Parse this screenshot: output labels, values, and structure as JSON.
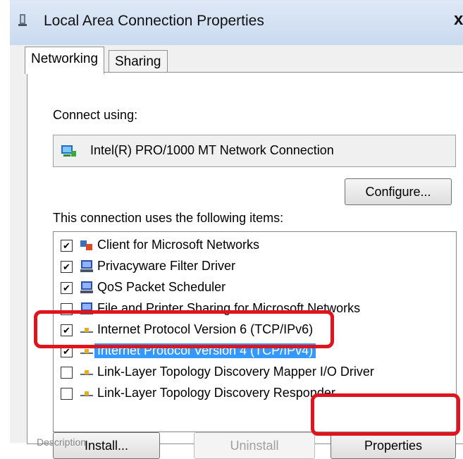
{
  "window": {
    "title": "Local Area Connection Properties",
    "close_label": "x"
  },
  "tabs": [
    {
      "label": "Networking"
    },
    {
      "label": "Sharing"
    }
  ],
  "connect_using": {
    "label": "Connect using:",
    "adapter": "Intel(R) PRO/1000 MT Network Connection",
    "configure_label": "Configure..."
  },
  "items_section": {
    "label": "This connection uses the following items:",
    "items": [
      {
        "label": "Client for Microsoft Networks",
        "checked": true,
        "icon": "network-client-icon"
      },
      {
        "label": "Privacyware Filter Driver",
        "checked": true,
        "icon": "monitor-icon"
      },
      {
        "label": "QoS Packet Scheduler",
        "checked": true,
        "icon": "monitor-icon"
      },
      {
        "label": "File and Printer Sharing for Microsoft Networks",
        "checked": false,
        "icon": "monitor-icon"
      },
      {
        "label": "Internet Protocol Version 6 (TCP/IPv6)",
        "checked": true,
        "icon": "protocol-icon"
      },
      {
        "label": "Internet Protocol Version 4 (TCP/IPv4)",
        "checked": true,
        "icon": "protocol-icon",
        "selected": true
      },
      {
        "label": "Link-Layer Topology Discovery Mapper I/O Driver",
        "checked": false,
        "icon": "protocol-icon"
      },
      {
        "label": "Link-Layer Topology Discovery Responder",
        "checked": false,
        "icon": "protocol-icon"
      }
    ]
  },
  "buttons": {
    "install": "Install...",
    "uninstall": "Uninstall",
    "properties": "Properties"
  },
  "description": {
    "label": "Description"
  },
  "colors": {
    "highlight": "#e0141e",
    "selection": "#3399ff"
  }
}
